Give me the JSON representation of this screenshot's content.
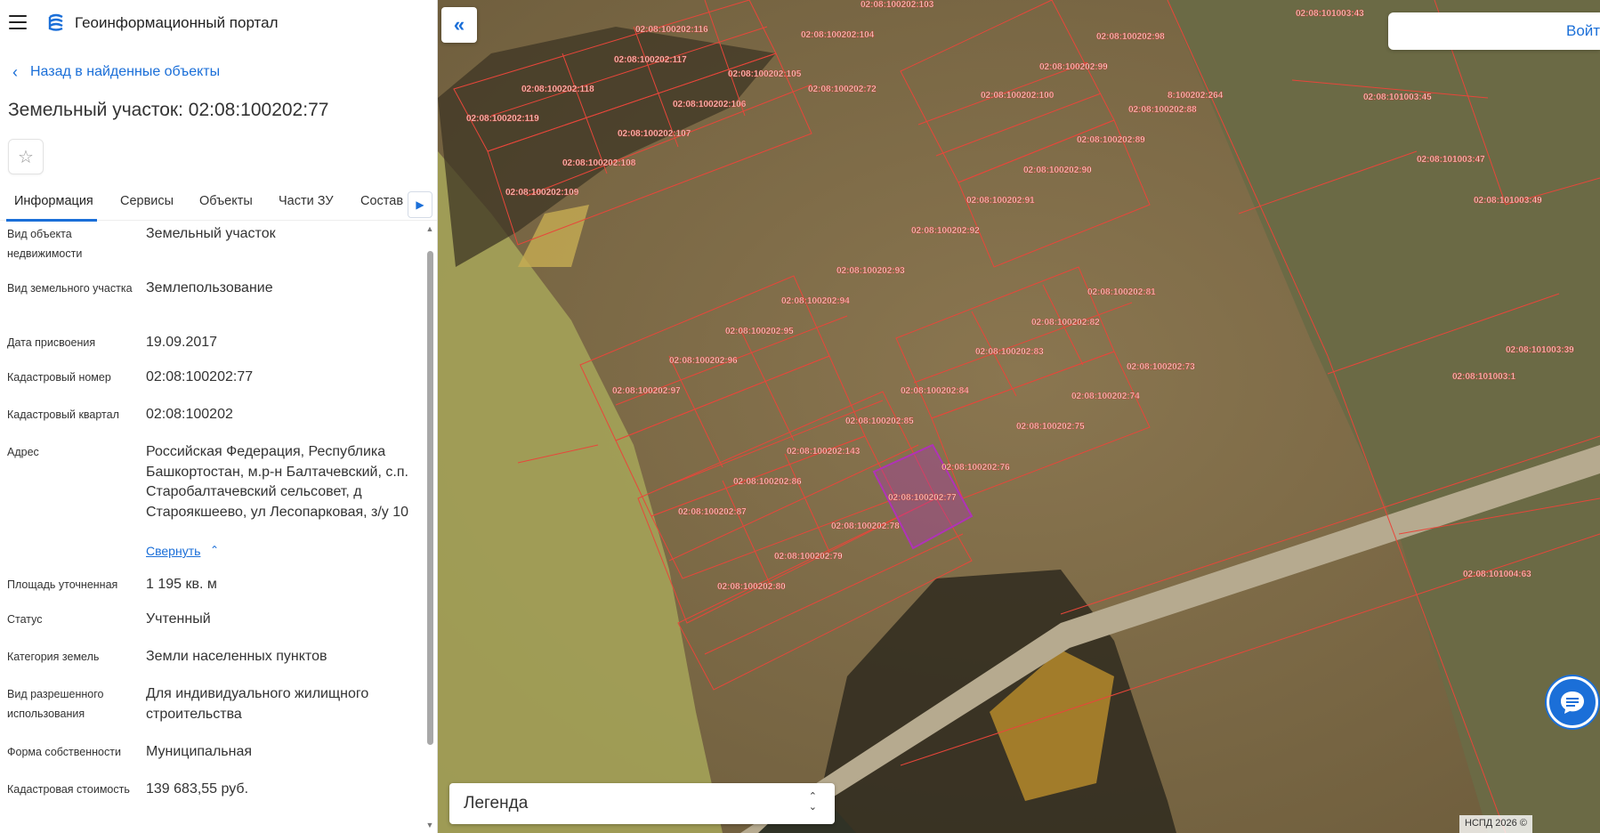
{
  "header": {
    "portal_title": "Геоинформационный портал"
  },
  "nav": {
    "back_label": "Назад в найденные объекты"
  },
  "object": {
    "title": "Земельный участок: 02:08:100202:77"
  },
  "tabs": [
    {
      "label": "Информация"
    },
    {
      "label": "Сервисы"
    },
    {
      "label": "Объекты"
    },
    {
      "label": "Части ЗУ"
    },
    {
      "label": "Состав"
    }
  ],
  "info": [
    {
      "label": "Вид объекта недвижимости",
      "value": "Земельный участок"
    },
    {
      "label": "Вид земельного участка",
      "value": "Землепользование"
    },
    {
      "label": "Дата присвоения",
      "value": "19.09.2017"
    },
    {
      "label": "Кадастровый номер",
      "value": "02:08:100202:77"
    },
    {
      "label": "Кадастровый квартал",
      "value": "02:08:100202"
    },
    {
      "label": "Адрес",
      "value": "Российская Федерация, Республика Башкортостан, м.р-н Балтачевский, с.п. Старобалтачевский сельсовет, д Староякшеево, ул Лесопарковая, з/у 10"
    },
    {
      "label": "Площадь уточненная",
      "value": "1 195 кв. м"
    },
    {
      "label": "Статус",
      "value": "Учтенный"
    },
    {
      "label": "Категория земель",
      "value": "Земли населенных пунктов"
    },
    {
      "label": "Вид разрешенного использования",
      "value": "Для индивидуального жилищного строительства"
    },
    {
      "label": "Форма собственности",
      "value": "Муниципальная"
    },
    {
      "label": "Кадастровая стоимость",
      "value": "139 683,55 руб."
    }
  ],
  "address_collapse_label": "Свернуть",
  "map": {
    "login_label": "Войти",
    "legend_label": "Легенда",
    "copyright": "НСПД 2026 ©",
    "highlight_color": "#b032b8",
    "parcel_line_color": "#e8463a",
    "parcels": [
      "02:08:100202:116",
      "02:08:100202:104",
      "02:08:100202:103",
      "02:08:100202:117",
      "02:08:100202:105",
      "02:08:100202:98",
      "02:08:100202:99",
      "02:08:100202:118",
      "02:08:100202:72",
      "02:08:100202:106",
      "02:08:100202:100",
      "02:08:100202:119",
      "02:08:100202:88",
      "02:08:100202:107",
      "02:08:100202:89",
      "02:08:100202:108",
      "02:08:100202:90",
      "02:08:100202:109",
      "02:08:100202:91",
      "02:08:100202:92",
      "02:08:100202:93",
      "02:08:100202:94",
      "02:08:100202:81",
      "02:08:100202:95",
      "02:08:100202:82",
      "02:08:100202:96",
      "02:08:100202:83",
      "02:08:100202:73",
      "02:08:100202:97",
      "02:08:100202:74",
      "02:08:100202:84",
      "02:08:100202:85",
      "02:08:100202:75",
      "02:08:100202:143",
      "02:08:100202:76",
      "02:08:100202:86",
      "02:08:100202:77",
      "02:08:100202:87",
      "02:08:100202:78",
      "02:08:100202:79",
      "02:08:100202:80",
      "02:08:101003:45",
      "02:08:101003:47",
      "02:08:101003:49",
      "02:08:101003:39",
      "02:08:101003:1",
      "02:08:101004:63",
      "02:08:101003:43",
      "8:100202:264"
    ]
  }
}
